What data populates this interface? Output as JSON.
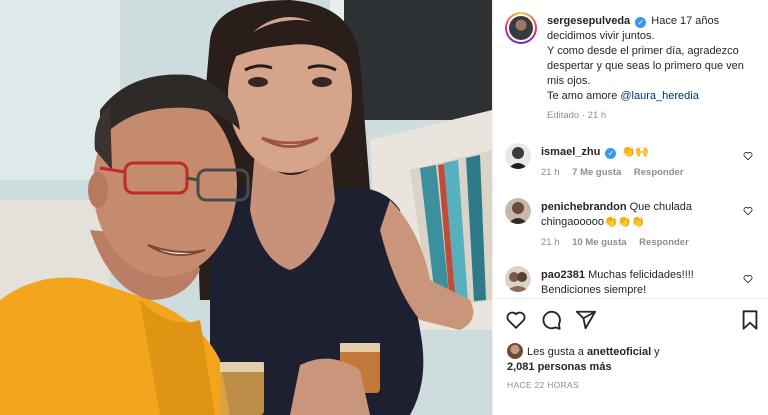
{
  "post": {
    "username": "sergesepulveda",
    "caption_lines": [
      "Hace 17 años decidimos vivir juntos.",
      "Y como desde el primer día, agradezco despertar y que seas lo primero que ven mis ojos.",
      "Te amo amore "
    ],
    "mention": "@laura_heredia",
    "edited_label": "Editado · 21 h"
  },
  "comments": [
    {
      "username": "ismael_zhu",
      "text": "👏🙌",
      "time": "21 h",
      "likes": "7 Me gusta",
      "reply": "Responder",
      "verified": true
    },
    {
      "username": "penichebrandon",
      "text": "Que chulada chingaooooo👏👏👏",
      "time": "21 h",
      "likes": "10 Me gusta",
      "reply": "Responder",
      "verified": false
    },
    {
      "username": "pao2381",
      "text": "Muchas felicidades!!!! Bendiciones siempre!",
      "verified": false
    }
  ],
  "likes_summary": {
    "prefix": "Les gusta a ",
    "user": "anetteoficial",
    "connector": " y",
    "count": "2,081 personas más"
  },
  "time_ago": "HACE 22 HORAS",
  "icons": [
    "heart-icon",
    "comment-icon",
    "share-icon",
    "bookmark-icon"
  ]
}
